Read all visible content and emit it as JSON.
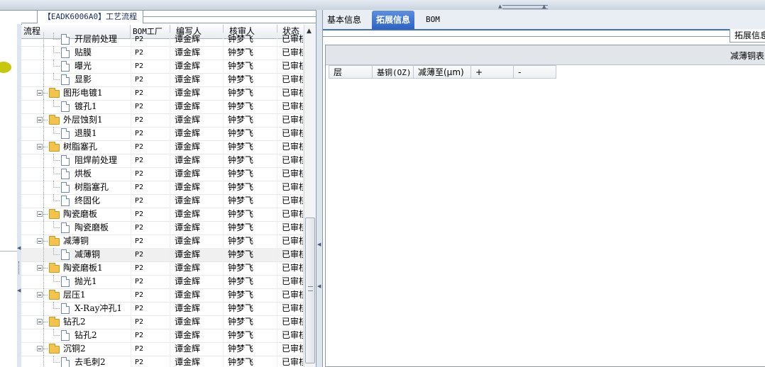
{
  "panel": {
    "title": "【EADK6006A0】工艺流程"
  },
  "grid": {
    "columns": [
      "流程",
      "BOM工厂",
      "编写人",
      "核审人",
      "状态"
    ],
    "rows": [
      {
        "name": "开层前处理",
        "type": "doc",
        "level": 2,
        "bom": "P2",
        "writer": "谭金辉",
        "reviewer": "钟梦飞",
        "status": "已审核"
      },
      {
        "name": "贴膜",
        "type": "doc",
        "level": 2,
        "bom": "P2",
        "writer": "谭金辉",
        "reviewer": "钟梦飞",
        "status": "已审核"
      },
      {
        "name": "曝光",
        "type": "doc",
        "level": 2,
        "bom": "P2",
        "writer": "谭金辉",
        "reviewer": "钟梦飞",
        "status": "已审核"
      },
      {
        "name": "显影",
        "type": "doc",
        "level": 2,
        "bom": "P2",
        "writer": "谭金辉",
        "reviewer": "钟梦飞",
        "status": "已审核"
      },
      {
        "name": "图形电镀1",
        "type": "folder",
        "level": 1,
        "bom": "P2",
        "writer": "谭金辉",
        "reviewer": "钟梦飞",
        "status": "已审核"
      },
      {
        "name": "镀孔1",
        "type": "doc",
        "level": 2,
        "bom": "P2",
        "writer": "谭金辉",
        "reviewer": "钟梦飞",
        "status": "已审核"
      },
      {
        "name": "外层蚀刻1",
        "type": "folder",
        "level": 1,
        "bom": "P2",
        "writer": "谭金辉",
        "reviewer": "钟梦飞",
        "status": "已审核"
      },
      {
        "name": "退膜1",
        "type": "doc",
        "level": 2,
        "bom": "P2",
        "writer": "谭金辉",
        "reviewer": "钟梦飞",
        "status": "已审核"
      },
      {
        "name": "树脂塞孔",
        "type": "folder",
        "level": 1,
        "bom": "P2",
        "writer": "谭金辉",
        "reviewer": "钟梦飞",
        "status": "已审核"
      },
      {
        "name": "阻焊前处理",
        "type": "doc",
        "level": 2,
        "bom": "P2",
        "writer": "谭金辉",
        "reviewer": "钟梦飞",
        "status": "已审核"
      },
      {
        "name": "烘板",
        "type": "doc",
        "level": 2,
        "bom": "P2",
        "writer": "谭金辉",
        "reviewer": "钟梦飞",
        "status": "已审核"
      },
      {
        "name": "树脂塞孔",
        "type": "doc",
        "level": 2,
        "bom": "P2",
        "writer": "谭金辉",
        "reviewer": "钟梦飞",
        "status": "已审核"
      },
      {
        "name": "终固化",
        "type": "doc",
        "level": 2,
        "bom": "P2",
        "writer": "谭金辉",
        "reviewer": "钟梦飞",
        "status": "已审核"
      },
      {
        "name": "陶瓷磨板",
        "type": "folder",
        "level": 1,
        "bom": "P2",
        "writer": "谭金辉",
        "reviewer": "钟梦飞",
        "status": "已审核"
      },
      {
        "name": "陶瓷磨板",
        "type": "doc",
        "level": 2,
        "bom": "P2",
        "writer": "谭金辉",
        "reviewer": "钟梦飞",
        "status": "已审核"
      },
      {
        "name": "减薄铜",
        "type": "folder",
        "level": 1,
        "bom": "P2",
        "writer": "谭金辉",
        "reviewer": "钟梦飞",
        "status": "已审核"
      },
      {
        "name": "减薄铜",
        "type": "doc",
        "level": 2,
        "bom": "P2",
        "writer": "谭金辉",
        "reviewer": "钟梦飞",
        "status": "已审核",
        "selected": true
      },
      {
        "name": "陶瓷磨板1",
        "type": "folder",
        "level": 1,
        "bom": "P2",
        "writer": "谭金辉",
        "reviewer": "钟梦飞",
        "status": "已审核"
      },
      {
        "name": "抛光1",
        "type": "doc",
        "level": 2,
        "bom": "P2",
        "writer": "谭金辉",
        "reviewer": "钟梦飞",
        "status": "已审核"
      },
      {
        "name": "层压1",
        "type": "folder",
        "level": 1,
        "bom": "P2",
        "writer": "谭金辉",
        "reviewer": "钟梦飞",
        "status": "已审核"
      },
      {
        "name": "X-Ray冲孔1",
        "type": "doc",
        "level": 2,
        "bom": "P2",
        "writer": "谭金辉",
        "reviewer": "钟梦飞",
        "status": "已审核"
      },
      {
        "name": "钻孔2",
        "type": "folder",
        "level": 1,
        "bom": "P2",
        "writer": "谭金辉",
        "reviewer": "钟梦飞",
        "status": "已审核"
      },
      {
        "name": "钻孔2",
        "type": "doc",
        "level": 2,
        "bom": "P2",
        "writer": "谭金辉",
        "reviewer": "钟梦飞",
        "status": "已审核"
      },
      {
        "name": "沉铜2",
        "type": "folder",
        "level": 1,
        "bom": "P2",
        "writer": "谭金辉",
        "reviewer": "钟梦飞",
        "status": "已审核"
      },
      {
        "name": "去毛刺2",
        "type": "doc",
        "level": 2,
        "bom": "P2",
        "writer": "谭金辉",
        "reviewer": "钟梦飞",
        "status": "已审核"
      }
    ]
  },
  "tabs": [
    {
      "label": "基本信息",
      "active": false
    },
    {
      "label": "拓展信息",
      "active": true
    },
    {
      "label": "BOM",
      "active": false
    }
  ],
  "subtab": {
    "label": "拓展信息"
  },
  "detail": {
    "title": "减薄铜表",
    "columns": [
      "层",
      "基铜(OZ)",
      "减薄至(μm)",
      "+",
      "-"
    ]
  }
}
